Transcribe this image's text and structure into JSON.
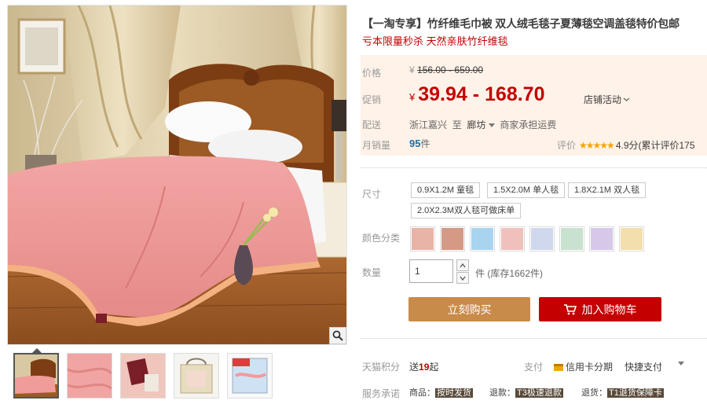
{
  "gallery": {
    "zoom_icon": "magnifier-icon",
    "thumbnails": [
      {
        "name": "thumb-bed-scene",
        "active": true
      },
      {
        "name": "thumb-pink-fabric",
        "active": false
      },
      {
        "name": "thumb-label-closeup",
        "active": false
      },
      {
        "name": "thumb-package-bag",
        "active": false
      },
      {
        "name": "thumb-blue-towel-package",
        "active": false
      }
    ]
  },
  "product": {
    "title": "【一淘专享】竹纤维毛巾被 双人绒毛毯子夏薄毯空调盖毯特价包邮",
    "subtitle": "亏本限量秒杀 天然亲肤竹纤维毯"
  },
  "price": {
    "label": "价格",
    "currency": "¥",
    "original": "156.00 - 659.00",
    "promo_label": "促销",
    "promo": "39.94 - 168.70",
    "shop_activity": "店铺活动",
    "shop_activity_icon": "chevron-down-icon"
  },
  "shipping": {
    "label": "配送",
    "from": "浙江嘉兴",
    "to_word": "至",
    "to": "廊坊",
    "dropdown_icon": "triangle-down-icon",
    "fee": "商家承担运费"
  },
  "sales": {
    "label": "月销量",
    "count": "95",
    "unit": "件",
    "rating_label": "评价",
    "stars": "★★★★★",
    "score": "4.9分(累计评价175"
  },
  "size": {
    "label": "尺寸",
    "options": [
      "0.9X1.2M 童毯",
      "1.5X2.0M 单人毯",
      "1.8X2.1M 双人毯",
      "2.0X2.3M双人毯可做床单"
    ]
  },
  "color": {
    "label": "颜色分类",
    "swatches": [
      "#e8b4a8",
      "#d59a86",
      "#a9d4ef",
      "#f0c0bc",
      "#cfd8ec",
      "#c9e2cf",
      "#d5c8e8",
      "#f3dfae"
    ]
  },
  "quantity": {
    "label": "数量",
    "value": "1",
    "note": "件 (库存1662件)",
    "up_icon": "arrow-up-icon",
    "down_icon": "arrow-down-icon"
  },
  "actions": {
    "buy_now": "立刻购买",
    "add_cart": "加入购物车",
    "cart_icon": "cart-icon",
    "buy_color": "#c98b4a",
    "cart_color": "#c40000"
  },
  "points": {
    "label": "天猫积分",
    "prefix": "送",
    "value": "19",
    "suffix": "起"
  },
  "payment": {
    "label": "支付",
    "credit": "信用卡分期",
    "quick": "快捷支付",
    "more_icon": "triangle-down-icon"
  },
  "promise": {
    "label": "服务承诺",
    "items": [
      {
        "prefix": "商品：",
        "tag": "按时发货",
        "style": "dark"
      },
      {
        "prefix": "退款：",
        "tag": "T3极速退款",
        "style": "dark"
      },
      {
        "prefix": "退货：",
        "tag": "T1退货保障卡",
        "style": "dark"
      }
    ]
  }
}
